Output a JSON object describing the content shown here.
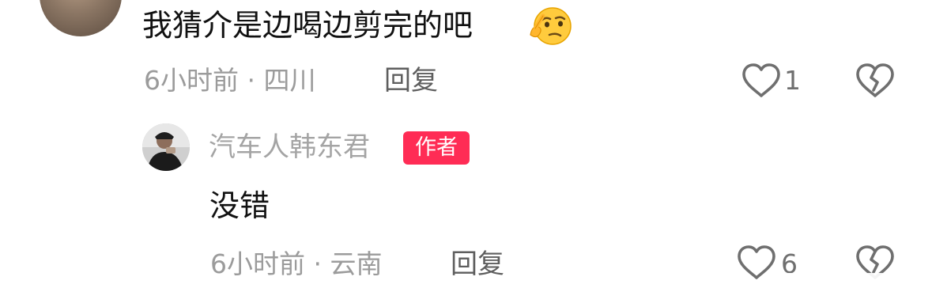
{
  "comment": {
    "text": "我猜介是边喝边剪完的吧",
    "emoji": "thinking-smirk-emoji",
    "meta": "6小时前 · 四川",
    "reply_label": "回复",
    "like_count": "1"
  },
  "reply": {
    "author": "汽车人韩东君",
    "badge": "作者",
    "text": "没错",
    "meta": "6小时前 · 云南",
    "reply_label": "回复",
    "like_count": "6"
  },
  "colors": {
    "badge": "#ff2c55",
    "meta": "#9b9b9b",
    "text": "#111111"
  }
}
